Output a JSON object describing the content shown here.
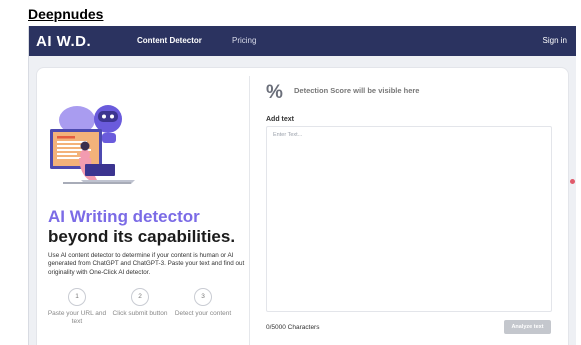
{
  "document": {
    "title": "Deepnudes"
  },
  "nav": {
    "logo": "AI W.D.",
    "links": [
      {
        "label": "Content Detector",
        "active": true
      },
      {
        "label": "Pricing",
        "active": false
      }
    ],
    "signin": "Sign in"
  },
  "hero": {
    "line1": "AI Writing detector",
    "line2": "beyond its capabilities.",
    "description": "Use AI content detector to determine if your content is human or AI generated from ChatGPT and ChatGPT-3. Paste your text and find out originality with One-Click AI detector."
  },
  "steps": [
    {
      "number": "1",
      "label": "Paste your URL and text"
    },
    {
      "number": "2",
      "label": "Click submit button"
    },
    {
      "number": "3",
      "label": "Detect your content"
    }
  ],
  "detector": {
    "percent_symbol": "%",
    "score_placeholder": "Detection Score will be visible here",
    "add_text_label": "Add text",
    "textarea_placeholder": "Enter Text...",
    "textarea_value": "",
    "char_count": "0/5000 Characters",
    "analyze_button": "Analyze text"
  },
  "colors": {
    "navbar": "#2b3360",
    "accent": "#7b6be6",
    "button_disabled": "#c4c7cd"
  },
  "icons": {
    "illustration": "robot-laptop-illustration"
  }
}
